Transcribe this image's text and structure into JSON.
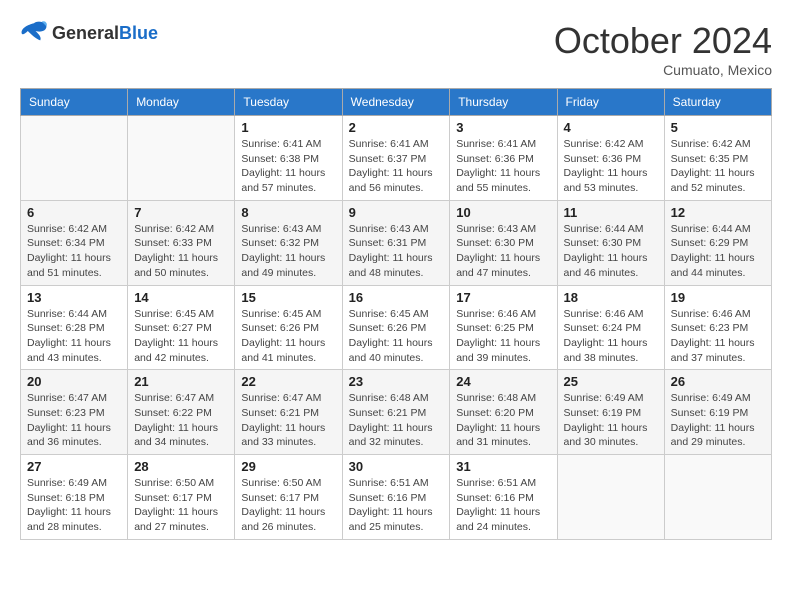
{
  "header": {
    "logo_general": "General",
    "logo_blue": "Blue",
    "month": "October 2024",
    "location": "Cumuato, Mexico"
  },
  "weekdays": [
    "Sunday",
    "Monday",
    "Tuesday",
    "Wednesday",
    "Thursday",
    "Friday",
    "Saturday"
  ],
  "weeks": [
    [
      {
        "day": "",
        "info": ""
      },
      {
        "day": "",
        "info": ""
      },
      {
        "day": "1",
        "info": "Sunrise: 6:41 AM\nSunset: 6:38 PM\nDaylight: 11 hours and 57 minutes."
      },
      {
        "day": "2",
        "info": "Sunrise: 6:41 AM\nSunset: 6:37 PM\nDaylight: 11 hours and 56 minutes."
      },
      {
        "day": "3",
        "info": "Sunrise: 6:41 AM\nSunset: 6:36 PM\nDaylight: 11 hours and 55 minutes."
      },
      {
        "day": "4",
        "info": "Sunrise: 6:42 AM\nSunset: 6:36 PM\nDaylight: 11 hours and 53 minutes."
      },
      {
        "day": "5",
        "info": "Sunrise: 6:42 AM\nSunset: 6:35 PM\nDaylight: 11 hours and 52 minutes."
      }
    ],
    [
      {
        "day": "6",
        "info": "Sunrise: 6:42 AM\nSunset: 6:34 PM\nDaylight: 11 hours and 51 minutes."
      },
      {
        "day": "7",
        "info": "Sunrise: 6:42 AM\nSunset: 6:33 PM\nDaylight: 11 hours and 50 minutes."
      },
      {
        "day": "8",
        "info": "Sunrise: 6:43 AM\nSunset: 6:32 PM\nDaylight: 11 hours and 49 minutes."
      },
      {
        "day": "9",
        "info": "Sunrise: 6:43 AM\nSunset: 6:31 PM\nDaylight: 11 hours and 48 minutes."
      },
      {
        "day": "10",
        "info": "Sunrise: 6:43 AM\nSunset: 6:30 PM\nDaylight: 11 hours and 47 minutes."
      },
      {
        "day": "11",
        "info": "Sunrise: 6:44 AM\nSunset: 6:30 PM\nDaylight: 11 hours and 46 minutes."
      },
      {
        "day": "12",
        "info": "Sunrise: 6:44 AM\nSunset: 6:29 PM\nDaylight: 11 hours and 44 minutes."
      }
    ],
    [
      {
        "day": "13",
        "info": "Sunrise: 6:44 AM\nSunset: 6:28 PM\nDaylight: 11 hours and 43 minutes."
      },
      {
        "day": "14",
        "info": "Sunrise: 6:45 AM\nSunset: 6:27 PM\nDaylight: 11 hours and 42 minutes."
      },
      {
        "day": "15",
        "info": "Sunrise: 6:45 AM\nSunset: 6:26 PM\nDaylight: 11 hours and 41 minutes."
      },
      {
        "day": "16",
        "info": "Sunrise: 6:45 AM\nSunset: 6:26 PM\nDaylight: 11 hours and 40 minutes."
      },
      {
        "day": "17",
        "info": "Sunrise: 6:46 AM\nSunset: 6:25 PM\nDaylight: 11 hours and 39 minutes."
      },
      {
        "day": "18",
        "info": "Sunrise: 6:46 AM\nSunset: 6:24 PM\nDaylight: 11 hours and 38 minutes."
      },
      {
        "day": "19",
        "info": "Sunrise: 6:46 AM\nSunset: 6:23 PM\nDaylight: 11 hours and 37 minutes."
      }
    ],
    [
      {
        "day": "20",
        "info": "Sunrise: 6:47 AM\nSunset: 6:23 PM\nDaylight: 11 hours and 36 minutes."
      },
      {
        "day": "21",
        "info": "Sunrise: 6:47 AM\nSunset: 6:22 PM\nDaylight: 11 hours and 34 minutes."
      },
      {
        "day": "22",
        "info": "Sunrise: 6:47 AM\nSunset: 6:21 PM\nDaylight: 11 hours and 33 minutes."
      },
      {
        "day": "23",
        "info": "Sunrise: 6:48 AM\nSunset: 6:21 PM\nDaylight: 11 hours and 32 minutes."
      },
      {
        "day": "24",
        "info": "Sunrise: 6:48 AM\nSunset: 6:20 PM\nDaylight: 11 hours and 31 minutes."
      },
      {
        "day": "25",
        "info": "Sunrise: 6:49 AM\nSunset: 6:19 PM\nDaylight: 11 hours and 30 minutes."
      },
      {
        "day": "26",
        "info": "Sunrise: 6:49 AM\nSunset: 6:19 PM\nDaylight: 11 hours and 29 minutes."
      }
    ],
    [
      {
        "day": "27",
        "info": "Sunrise: 6:49 AM\nSunset: 6:18 PM\nDaylight: 11 hours and 28 minutes."
      },
      {
        "day": "28",
        "info": "Sunrise: 6:50 AM\nSunset: 6:17 PM\nDaylight: 11 hours and 27 minutes."
      },
      {
        "day": "29",
        "info": "Sunrise: 6:50 AM\nSunset: 6:17 PM\nDaylight: 11 hours and 26 minutes."
      },
      {
        "day": "30",
        "info": "Sunrise: 6:51 AM\nSunset: 6:16 PM\nDaylight: 11 hours and 25 minutes."
      },
      {
        "day": "31",
        "info": "Sunrise: 6:51 AM\nSunset: 6:16 PM\nDaylight: 11 hours and 24 minutes."
      },
      {
        "day": "",
        "info": ""
      },
      {
        "day": "",
        "info": ""
      }
    ]
  ]
}
